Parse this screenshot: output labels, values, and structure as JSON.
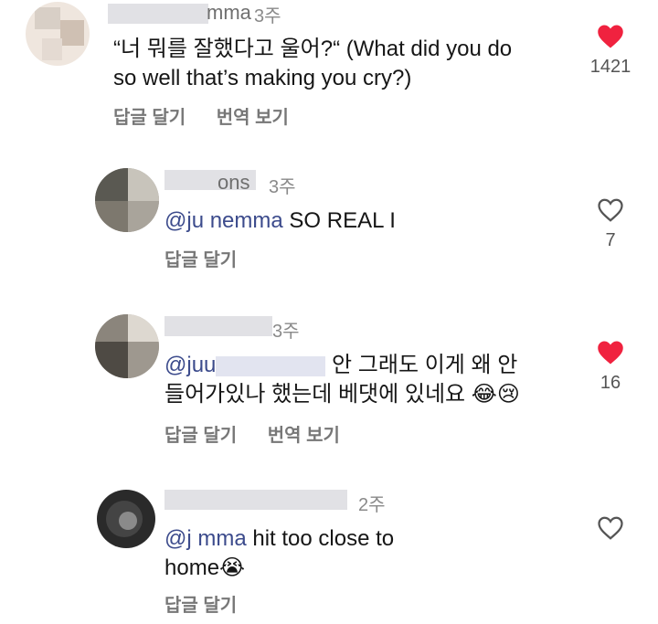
{
  "comments": [
    {
      "username": "mma",
      "time": "3주",
      "text_line1": "“너 뭐를 잘했다고 울어?“ (What did you do",
      "text_line2": "so well that’s making you cry?)",
      "reply_label": "답글 달기",
      "translate_label": "번역 보기",
      "liked": true,
      "like_count": "1421"
    },
    {
      "username": "ons",
      "time": "3주",
      "mention": "@ju      nemma",
      "text_line1": " SO REAL I",
      "reply_label": "답글 달기",
      "liked": false,
      "like_count": "7"
    },
    {
      "username": "",
      "time": "3주",
      "mention": "@juu",
      "text_line1": " 안 그래도 이게 왜 안",
      "text_line2": "들어가있나 했는데 베댓에 있네요 😂😢",
      "reply_label": "답글 달기",
      "translate_label": "번역 보기",
      "liked": true,
      "like_count": "16"
    },
    {
      "username": "",
      "time": "2주",
      "mention": "@j         mma",
      "text_line1": " hit too close to",
      "text_line2": "home😭",
      "reply_label": "답글 달기",
      "liked": false,
      "like_count": ""
    }
  ],
  "colors": {
    "heart_filled": "#f0223f",
    "heart_outline": "#555555"
  },
  "icons": [
    "heart-filled-icon",
    "heart-outline-icon"
  ]
}
